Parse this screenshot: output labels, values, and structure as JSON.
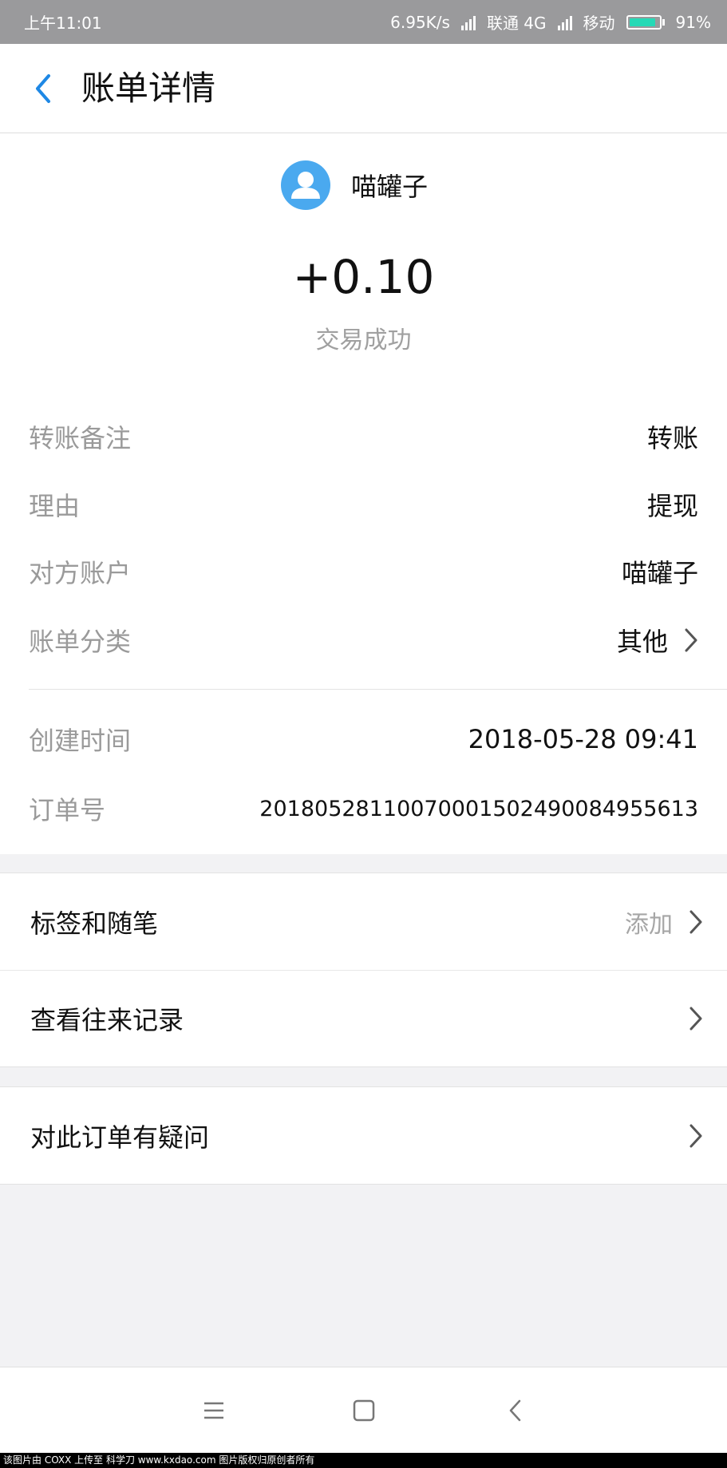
{
  "status_bar": {
    "time": "上午11:01",
    "speed": "6.95K/s",
    "carrier1": "联通 4G",
    "carrier2": "移动",
    "battery": "91%",
    "battery_level": 0.91,
    "battery_color": "#26d9b6"
  },
  "header": {
    "title": "账单详情",
    "back_icon": "chevron-left-icon",
    "accent_color": "#1e88e5"
  },
  "payee": {
    "avatar_icon": "user-icon",
    "avatar_color": "#4aa9ef",
    "name": "喵罐子"
  },
  "amount": "+0.10",
  "status": "交易成功",
  "details": [
    {
      "label": "转账备注",
      "value": "转账"
    },
    {
      "label": "理由",
      "value": "提现"
    },
    {
      "label": "对方账户",
      "value": "喵罐子"
    },
    {
      "label": "账单分类",
      "value": "其他"
    }
  ],
  "meta": [
    {
      "label": "创建时间",
      "value": "2018-05-28 09:41"
    },
    {
      "label": "订单号",
      "value": "20180528110070001502490084955613"
    }
  ],
  "actions": {
    "tags": {
      "label": "标签和随笔",
      "hint": "添加"
    },
    "history": {
      "label": "查看往来记录"
    },
    "question": {
      "label": "对此订单有疑问"
    }
  },
  "system_nav": {
    "menu_icon": "menu-icon",
    "home_icon": "home-square-icon",
    "back_icon": "back-triangle-icon"
  },
  "watermark": "该图片由 COXX 上传至 科学刀 www.kxdao.com 图片版权归原创者所有"
}
